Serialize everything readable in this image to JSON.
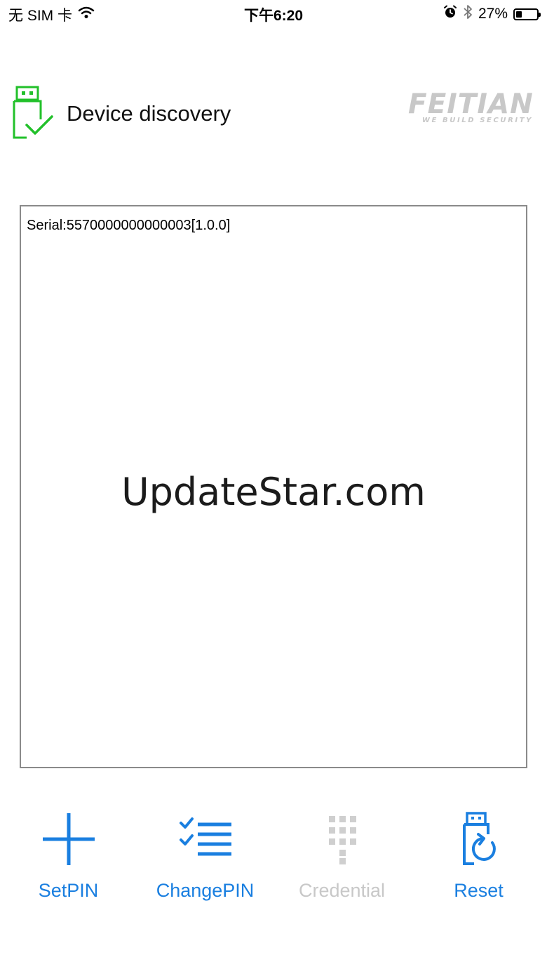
{
  "status_bar": {
    "carrier": "无 SIM 卡",
    "time": "下午6:20",
    "battery_percent": "27%",
    "battery_level": 0.27
  },
  "header": {
    "title": "Device discovery",
    "brand_name": "FEITIAN",
    "brand_tagline": "WE BUILD SECURITY"
  },
  "log": {
    "serial_line": "Serial:5570000000000003[1.0.0]",
    "watermark": "UpdateStar.com"
  },
  "toolbar": {
    "items": [
      {
        "label": "SetPIN",
        "icon": "plus-icon",
        "enabled": true
      },
      {
        "label": "ChangePIN",
        "icon": "checklist-icon",
        "enabled": true
      },
      {
        "label": "Credential",
        "icon": "keypad-icon",
        "enabled": false
      },
      {
        "label": "Reset",
        "icon": "usb-reset-icon",
        "enabled": true
      }
    ]
  },
  "colors": {
    "accent_blue": "#1a7fe0",
    "device_green": "#22c02a",
    "disabled_gray": "#c8c8c8",
    "border_gray": "#8a8a8a"
  }
}
